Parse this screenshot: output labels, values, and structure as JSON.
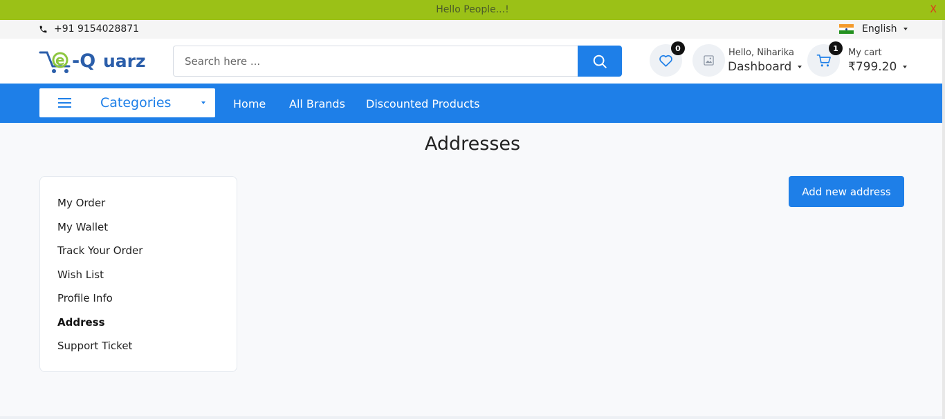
{
  "announcement": {
    "text": "Hello People...!",
    "close": "X"
  },
  "topbar": {
    "phone": "+91 9154028871",
    "language": "English"
  },
  "header": {
    "logo_text": "e-Quarz",
    "search": {
      "placeholder": "Search here ..."
    },
    "wishlist": {
      "count": "0"
    },
    "account": {
      "greeting": "Hello, Niharika",
      "label": "Dashboard"
    },
    "cart": {
      "count": "1",
      "label": "My cart",
      "total": "₹799.20"
    }
  },
  "nav": {
    "categories_label": "Categories",
    "links": [
      "Home",
      "All Brands",
      "Discounted Products"
    ]
  },
  "main": {
    "title": "Addresses",
    "add_button": "Add new address",
    "sidebar": [
      "My Order",
      "My Wallet",
      "Track Your Order",
      "Wish List",
      "Profile Info",
      "Address",
      "Support Ticket"
    ],
    "active_item": "Address"
  },
  "colors": {
    "primary": "#1e7fe8",
    "announcement_bg": "#9bc117",
    "close": "#e0321b"
  },
  "icons": [
    "phone-icon",
    "india-flag-icon",
    "search-icon",
    "heart-icon",
    "image-placeholder-icon",
    "cart-icon",
    "hamburger-icon",
    "chevron-down-icon"
  ]
}
